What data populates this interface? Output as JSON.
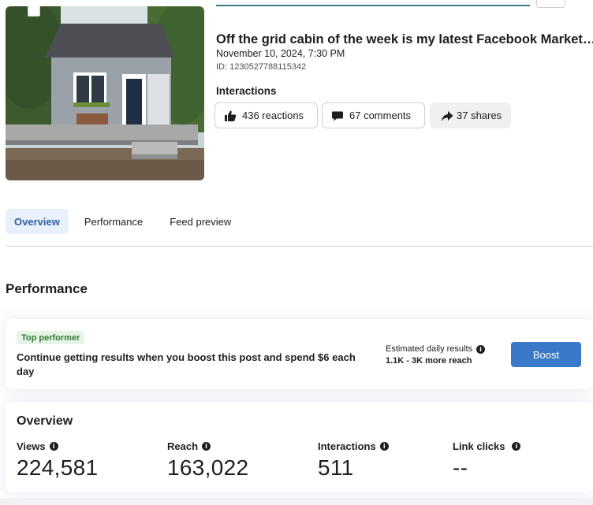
{
  "post": {
    "title": "Off the grid cabin of the week is my latest Facebook Market…",
    "date": "November 10, 2024, 7:30 PM",
    "id": "ID: 1230527788115342"
  },
  "interactions": {
    "heading": "Interactions",
    "reactions": "436 reactions",
    "comments": "67 comments",
    "shares": "37 shares"
  },
  "tabs": [
    {
      "label": "Overview",
      "active": true
    },
    {
      "label": "Performance",
      "active": false
    },
    {
      "label": "Feed preview",
      "active": false
    }
  ],
  "performance": {
    "title": "Performance",
    "badge": "Top performer",
    "message": "Continue getting results when you boost this post and spend $6 each day",
    "estimate_label": "Estimated daily results",
    "estimate_value": "1.1K - 3K more reach",
    "boost_label": "Boost"
  },
  "overview": {
    "title": "Overview",
    "metrics": [
      {
        "label": "Views",
        "value": "224,581"
      },
      {
        "label": "Reach",
        "value": "163,022"
      },
      {
        "label": "Interactions",
        "value": "511"
      },
      {
        "label": "Link clicks",
        "value": "--"
      }
    ]
  },
  "colors": {
    "accent": "#3a78c9",
    "tab_active_bg": "#e7f0fb",
    "badge_bg": "#e6f4e8",
    "badge_text": "#2e7d32"
  },
  "icons": {
    "reactions": "thumbs-up-icon",
    "comments": "comment-bubble-icon",
    "shares": "share-arrow-icon",
    "info": "info-icon"
  }
}
